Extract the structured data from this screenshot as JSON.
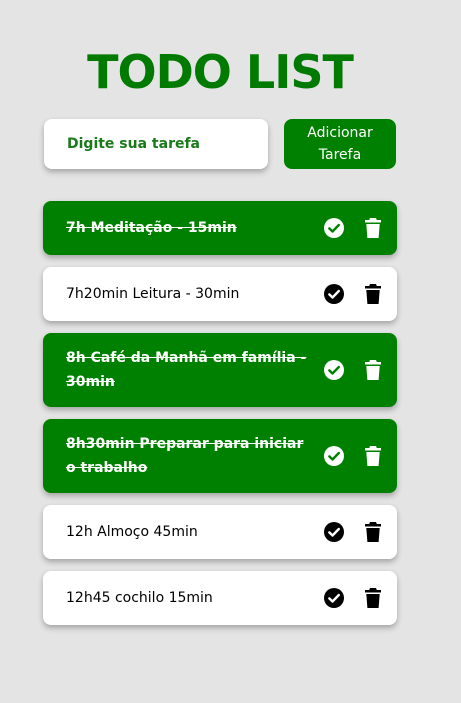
{
  "header": {
    "title": "TODO LIST"
  },
  "form": {
    "input_placeholder": "Digite sua tarefa",
    "add_button_label": "Adicionar Tarefa"
  },
  "colors": {
    "accent": "#008000",
    "background": "#e4e4e4",
    "card": "#ffffff"
  },
  "tasks": [
    {
      "text": "7h Meditação - 15min",
      "completed": true
    },
    {
      "text": "7h20min Leitura - 30min",
      "completed": false
    },
    {
      "text": "8h Café da Manhã em família - 30min",
      "completed": true
    },
    {
      "text": "8h30min Preparar para iniciar o trabalho",
      "completed": true
    },
    {
      "text": "12h Almoço 45min",
      "completed": false
    },
    {
      "text": "12h45 cochilo 15min",
      "completed": false
    }
  ],
  "icons": {
    "complete": "check-circle-icon",
    "delete": "trash-icon"
  }
}
